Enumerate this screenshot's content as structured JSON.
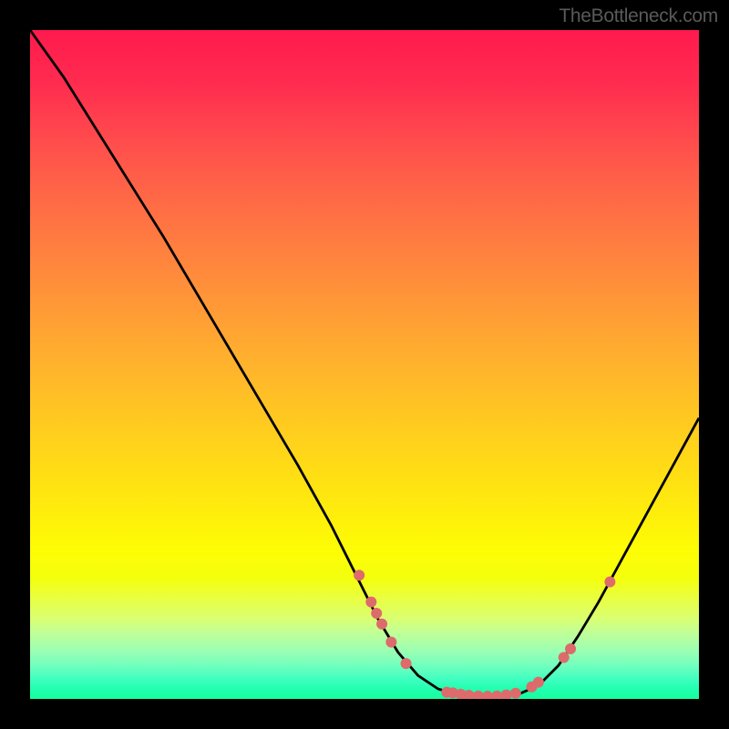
{
  "watermark": "TheBottleneck.com",
  "chart_data": {
    "type": "line",
    "title": "",
    "xlabel": "",
    "ylabel": "",
    "xlim": [
      0,
      100
    ],
    "ylim": [
      0,
      100
    ],
    "grid": false,
    "series": [
      {
        "name": "curve",
        "color": "#000000",
        "points": [
          [
            0,
            100
          ],
          [
            5,
            93
          ],
          [
            10,
            85
          ],
          [
            15,
            77
          ],
          [
            20,
            69
          ],
          [
            25,
            60.5
          ],
          [
            30,
            52
          ],
          [
            35,
            43.5
          ],
          [
            40,
            35
          ],
          [
            45,
            26
          ],
          [
            49,
            18
          ],
          [
            52,
            12
          ],
          [
            55,
            7
          ],
          [
            58,
            3.5
          ],
          [
            61,
            1.5
          ],
          [
            64,
            0.6
          ],
          [
            67,
            0.3
          ],
          [
            70,
            0.3
          ],
          [
            73,
            0.7
          ],
          [
            76,
            2
          ],
          [
            79,
            5
          ],
          [
            82,
            9.5
          ],
          [
            85,
            14.5
          ],
          [
            88,
            20
          ],
          [
            91,
            25.5
          ],
          [
            94,
            31
          ],
          [
            97,
            36.5
          ],
          [
            100,
            42
          ]
        ]
      }
    ],
    "dots": {
      "color": "#dd6b6b",
      "radius": 6,
      "points": [
        [
          49.2,
          18.5
        ],
        [
          51.0,
          14.5
        ],
        [
          51.8,
          12.8
        ],
        [
          52.6,
          11.2
        ],
        [
          54.0,
          8.5
        ],
        [
          56.2,
          5.3
        ],
        [
          62.3,
          1.0
        ],
        [
          63.2,
          0.9
        ],
        [
          64.4,
          0.7
        ],
        [
          65.6,
          0.55
        ],
        [
          67.0,
          0.45
        ],
        [
          68.4,
          0.4
        ],
        [
          69.8,
          0.45
        ],
        [
          71.2,
          0.6
        ],
        [
          72.6,
          0.85
        ],
        [
          75.0,
          1.8
        ],
        [
          76.0,
          2.5
        ],
        [
          79.8,
          6.2
        ],
        [
          80.8,
          7.5
        ],
        [
          86.7,
          17.5
        ]
      ]
    }
  }
}
